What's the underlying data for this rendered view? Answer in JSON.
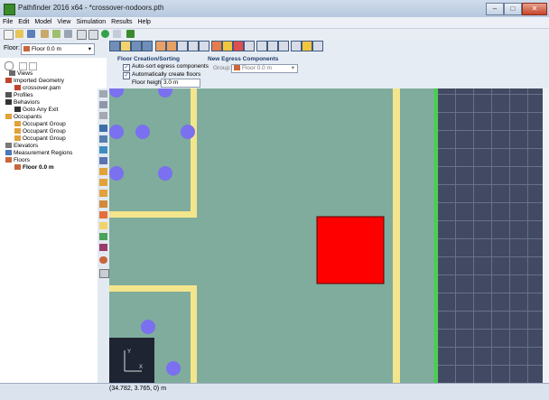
{
  "window": {
    "title": "Pathfinder 2016 x64 - *crossover-nodoors.pth"
  },
  "menu": [
    "File",
    "Edit",
    "Model",
    "View",
    "Simulation",
    "Results",
    "Help"
  ],
  "floor_bar": {
    "label": "Floor:",
    "selected": "Floor 0.0 m"
  },
  "tree": {
    "items": [
      {
        "label": "Views",
        "indent": 1,
        "bold": false
      },
      {
        "label": "Imported Geometry",
        "indent": 0,
        "bold": false
      },
      {
        "label": "crossover.pam",
        "indent": 1,
        "bold": false
      },
      {
        "label": "Profiles",
        "indent": 0,
        "bold": false
      },
      {
        "label": "Behaviors",
        "indent": 0,
        "bold": false
      },
      {
        "label": "Goto Any Exit",
        "indent": 1,
        "bold": false
      },
      {
        "label": "Occupants",
        "indent": 0,
        "bold": false
      },
      {
        "label": "Occupant Group",
        "indent": 1,
        "bold": false
      },
      {
        "label": "Occupant Group",
        "indent": 1,
        "bold": false
      },
      {
        "label": "Occupant Group",
        "indent": 1,
        "bold": false
      },
      {
        "label": "Elevators",
        "indent": 0,
        "bold": false
      },
      {
        "label": "Measurement Regions",
        "indent": 0,
        "bold": false
      },
      {
        "label": "Floors",
        "indent": 0,
        "bold": false
      },
      {
        "label": "Floor 0.0 m",
        "indent": 1,
        "bold": true
      }
    ]
  },
  "floor_creation": {
    "title": "Floor Creation/Sorting",
    "auto_sort": "Auto-sort egress components",
    "auto_create": "Automatically create floors",
    "height_label": "Floor height:",
    "height_value": "3.0 m"
  },
  "new_egress": {
    "title": "New Egress Components",
    "group_label": "Group:",
    "group_value": "Floor 0.0 m"
  },
  "status": {
    "coordinates": "(34.782, 3.765, 0) m"
  },
  "colors": {
    "floor": "#7fac9c",
    "wall": "#f3e58c",
    "occupant": "#7a70f0",
    "obstacle": "#ff0000",
    "grid_bg": "#424a63",
    "exit_line": "#33dd33"
  }
}
